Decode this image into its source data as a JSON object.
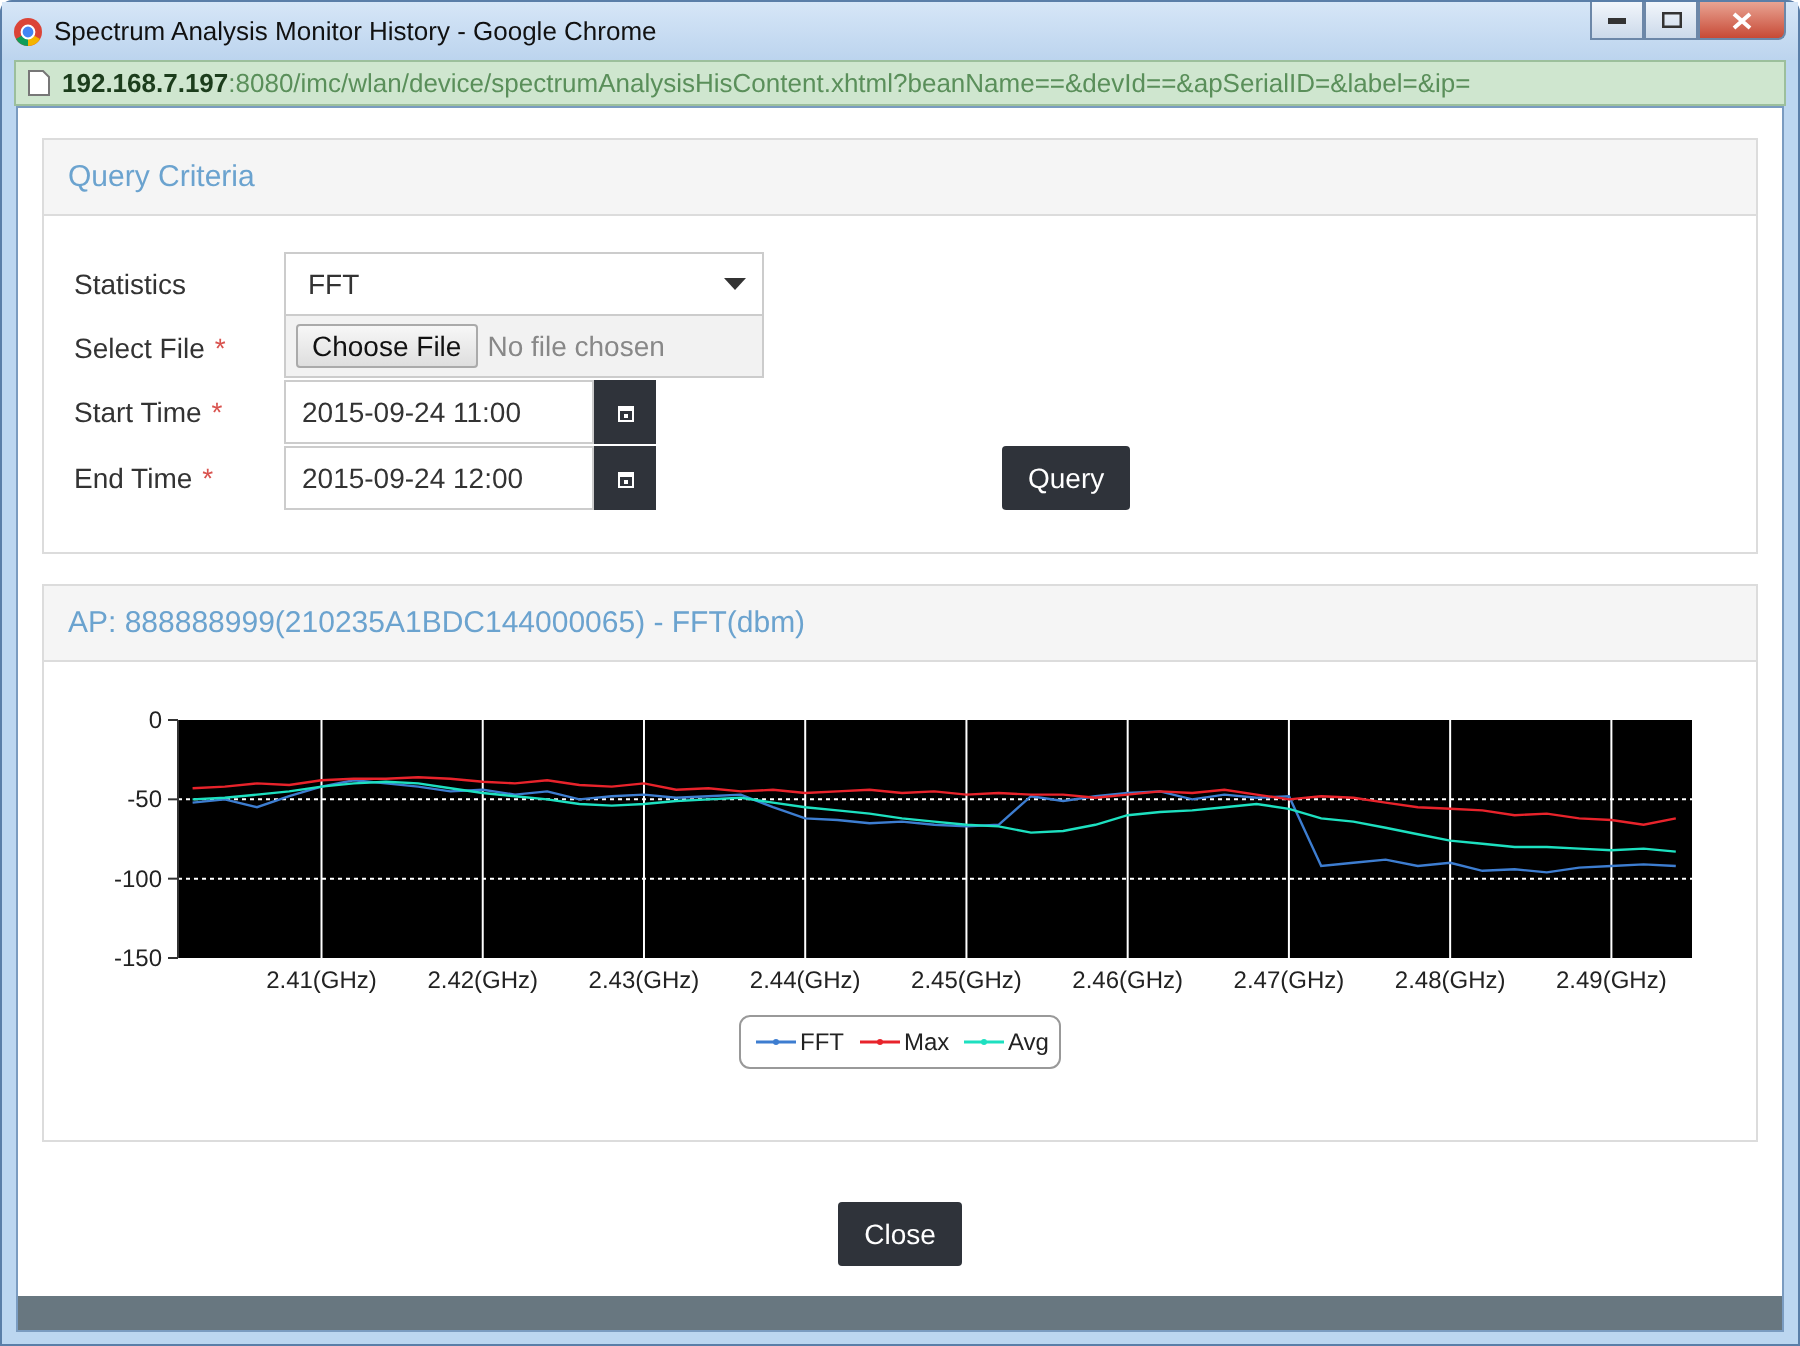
{
  "window": {
    "title": "Spectrum Analysis Monitor History - Google Chrome",
    "address_host": "192.168.7.197",
    "address_path": ":8080/imc/wlan/device/spectrumAnalysisHisContent.xhtml?beanName==&devId==&apSerialID=&label=&ip="
  },
  "query_panel": {
    "title": "Query Criteria",
    "fields": [
      {
        "kind": "select",
        "label": "Statistics",
        "value": "FFT"
      },
      {
        "kind": "file",
        "label": "Select File",
        "marker": "*",
        "button": "Choose File",
        "status": "No file chosen"
      },
      {
        "kind": "date",
        "label": "Start Time",
        "marker": "*",
        "value": "2015-09-24 11:00"
      },
      {
        "kind": "date",
        "label": "End Time",
        "marker": "*",
        "value": "2015-09-24 12:00"
      }
    ],
    "query_button": "Query"
  },
  "chart_panel": {
    "title": "AP: 888888999(210235A1BDC144000065) - FFT(dbm)",
    "chart_data": {
      "type": "line",
      "grid": true,
      "legend": "bottom",
      "xlim": [
        2.4011,
        2.495
      ],
      "ylim": [
        -150,
        0
      ],
      "yticks": [
        0,
        -50,
        -100,
        -150
      ],
      "xticks": [
        {
          "value": 2.41,
          "label": "2.41(GHz)"
        },
        {
          "value": 2.42,
          "label": "2.42(GHz)"
        },
        {
          "value": 2.43,
          "label": "2.43(GHz)"
        },
        {
          "value": 2.44,
          "label": "2.44(GHz)"
        },
        {
          "value": 2.45,
          "label": "2.45(GHz)"
        },
        {
          "value": 2.46,
          "label": "2.46(GHz)"
        },
        {
          "value": 2.47,
          "label": "2.47(GHz)"
        },
        {
          "value": 2.48,
          "label": "2.48(GHz)"
        },
        {
          "value": 2.49,
          "label": "2.49(GHz)"
        }
      ],
      "x": [
        2.402,
        2.404,
        2.406,
        2.408,
        2.41,
        2.412,
        2.414,
        2.416,
        2.418,
        2.42,
        2.422,
        2.424,
        2.426,
        2.428,
        2.43,
        2.432,
        2.434,
        2.436,
        2.438,
        2.44,
        2.442,
        2.444,
        2.446,
        2.448,
        2.45,
        2.452,
        2.454,
        2.456,
        2.458,
        2.46,
        2.462,
        2.464,
        2.466,
        2.468,
        2.47,
        2.472,
        2.474,
        2.476,
        2.478,
        2.48,
        2.482,
        2.484,
        2.486,
        2.488,
        2.49,
        2.492,
        2.494
      ],
      "series": [
        {
          "name": "FFT",
          "color": "#3d7dd0",
          "values": [
            -52,
            -50,
            -55,
            -48,
            -42,
            -38,
            -40,
            -42,
            -45,
            -44,
            -47,
            -45,
            -50,
            -48,
            -47,
            -49,
            -48,
            -47,
            -55,
            -62,
            -63,
            -65,
            -64,
            -66,
            -67,
            -66,
            -48,
            -51,
            -48,
            -46,
            -45,
            -50,
            -47,
            -49,
            -48,
            -92,
            -90,
            -88,
            -92,
            -90,
            -95,
            -94,
            -96,
            -93,
            -92,
            -91,
            -92
          ]
        },
        {
          "name": "Max",
          "color": "#e8232b",
          "values": [
            -43,
            -42,
            -40,
            -41,
            -38,
            -37,
            -37,
            -36,
            -37,
            -39,
            -40,
            -38,
            -41,
            -42,
            -40,
            -44,
            -43,
            -45,
            -44,
            -46,
            -45,
            -44,
            -46,
            -45,
            -47,
            -46,
            -47,
            -47,
            -49,
            -47,
            -45,
            -46,
            -44,
            -47,
            -50,
            -48,
            -49,
            -52,
            -55,
            -56,
            -57,
            -60,
            -59,
            -62,
            -63,
            -66,
            -62
          ]
        },
        {
          "name": "Avg",
          "color": "#1de0c0",
          "values": [
            -50,
            -49,
            -47,
            -45,
            -42,
            -40,
            -39,
            -40,
            -43,
            -46,
            -48,
            -50,
            -53,
            -54,
            -53,
            -51,
            -50,
            -49,
            -52,
            -55,
            -57,
            -59,
            -62,
            -64,
            -66,
            -67,
            -71,
            -70,
            -66,
            -60,
            -58,
            -57,
            -55,
            -53,
            -56,
            -62,
            -64,
            -68,
            -72,
            -76,
            -78,
            -80,
            -80,
            -81,
            -82,
            -81,
            -83
          ]
        }
      ]
    }
  },
  "close_button": "Close"
}
